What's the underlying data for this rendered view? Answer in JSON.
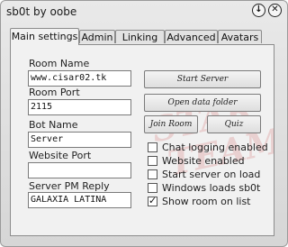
{
  "window": {
    "title": "sb0t by oobe"
  },
  "title_buttons": {
    "minimize_glyph": "↓",
    "close_glyph": "✕"
  },
  "tabs": [
    {
      "label": "Main settings",
      "active": true
    },
    {
      "label": "Admin",
      "active": false
    },
    {
      "label": "Linking",
      "active": false
    },
    {
      "label": "Advanced",
      "active": false
    },
    {
      "label": "Avatars",
      "active": false
    }
  ],
  "fields": {
    "room_name": {
      "label": "Room Name",
      "value": "www.cisar02.tk"
    },
    "room_port": {
      "label": "Room Port",
      "value": "2115"
    },
    "bot_name": {
      "label": "Bot Name",
      "value": "Server"
    },
    "website_port": {
      "label": "Website Port",
      "value": ""
    },
    "server_pm_reply": {
      "label": "Server PM Reply",
      "value": "GALAXIA LATINA"
    }
  },
  "buttons": {
    "start_server": "Start Server",
    "open_data_folder": "Open data folder",
    "join_room": "Join Room",
    "quiz": "Quiz"
  },
  "checkboxes": [
    {
      "label": "Chat logging enabled",
      "checked": false
    },
    {
      "label": "Website enabled",
      "checked": false
    },
    {
      "label": "Start server on load",
      "checked": false
    },
    {
      "label": "Windows loads sb0t",
      "checked": false
    },
    {
      "label": "Show room on list",
      "checked": true
    }
  ],
  "watermark": {
    "line1": "STAR",
    "line2": "TEAM"
  }
}
